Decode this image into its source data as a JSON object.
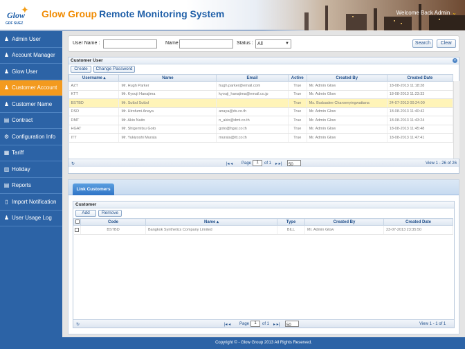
{
  "header": {
    "brand": "Glow Group",
    "system": "Remote Monitoring System",
    "logo_text": "Glow",
    "logo_sub": "GDF SUEZ",
    "welcome": "Welcome Back Admin"
  },
  "sidebar": {
    "items": [
      {
        "label": "Admin User",
        "icon": "user-icon"
      },
      {
        "label": "Account Manager",
        "icon": "user-icon"
      },
      {
        "label": "Glow User",
        "icon": "user-icon"
      },
      {
        "label": "Customer Account",
        "icon": "user-icon",
        "active": true
      },
      {
        "label": "Customer Name",
        "icon": "user-icon"
      },
      {
        "label": "Contract",
        "icon": "contract-icon"
      },
      {
        "label": "Configuration Info",
        "icon": "gears-icon"
      },
      {
        "label": "Tariff",
        "icon": "table-icon"
      },
      {
        "label": "Holiday",
        "icon": "calendar-icon"
      },
      {
        "label": "Reports",
        "icon": "report-icon"
      },
      {
        "label": "Import Notification",
        "icon": "bookmark-icon"
      },
      {
        "label": "User Usage Log",
        "icon": "user-icon"
      }
    ]
  },
  "search": {
    "username_label": "User Name :",
    "name_label": "Name :",
    "status_label": "Status :",
    "status_value": "All",
    "search_btn": "Search",
    "clear_btn": "Clear"
  },
  "customer_user": {
    "title": "Customer User",
    "create_btn": "Create",
    "change_pw_btn": "Change Password",
    "columns": [
      "Username",
      "Name",
      "Email",
      "Active",
      "Created By",
      "Created Date"
    ],
    "rows": [
      [
        "AZT",
        "Mr. Hugh Parker",
        "hugh.parker@email.com",
        "True",
        "Mr. Admin Glow",
        "18-08-2013 11:18:28"
      ],
      [
        "KTT",
        "Mr. Kyouji Hanajima",
        "kyouji_hanajima@email.co.jp",
        "True",
        "Mr. Admin Glow",
        "18-08-2013 11:23:33"
      ],
      [
        "BSTBD",
        "Mr. Sutbd Sutbd",
        "",
        "True",
        "Ms. Budsadee Charoenyingwattana",
        "24-07-2013 00:24:00"
      ],
      [
        "DSD",
        "Mr. Hirofumi Anaya",
        "anaya@ds.co.th",
        "True",
        "Mr. Admin Glow",
        "18-08-2013 11:40:42"
      ],
      [
        "DMT",
        "Mr. Akio Naito",
        "n_akio@dmt.co.th",
        "True",
        "Mr. Admin Glow",
        "18-08-2013 11:43:24"
      ],
      [
        "HGAT",
        "Mr. Shigemitsu Goto",
        "goto@hgat.co.th",
        "True",
        "Mr. Admin Glow",
        "18-08-2013 11:45:48"
      ],
      [
        "ITT",
        "Mr. Yukiyoshi Murata",
        "murata@itt.co.th",
        "True",
        "Mr. Admin Glow",
        "18-08-2013 11:47:41"
      ]
    ],
    "pager": {
      "page_label": "Page",
      "page": "1",
      "of": "of 1",
      "size": "50",
      "view": "View 1 - 26 of 26"
    }
  },
  "link": {
    "tab_label": "Link Customers",
    "title": "Customer",
    "add_btn": "Add",
    "remove_btn": "Remove",
    "columns": [
      "Code",
      "Name",
      "Type",
      "Created By",
      "Created Date"
    ],
    "rows": [
      [
        "BSTBD",
        "Bangkok Synthetics Company Limited",
        "BILL",
        "Mr. Admin Glow",
        "23-07-2013 23:35:50"
      ]
    ],
    "pager": {
      "page_label": "Page",
      "page": "1",
      "of": "of 1",
      "size": "50",
      "view": "View 1 - 1 of 1"
    }
  },
  "footer": {
    "text": "Copyright © - Glow Group 2013 All Rights Reserved."
  }
}
